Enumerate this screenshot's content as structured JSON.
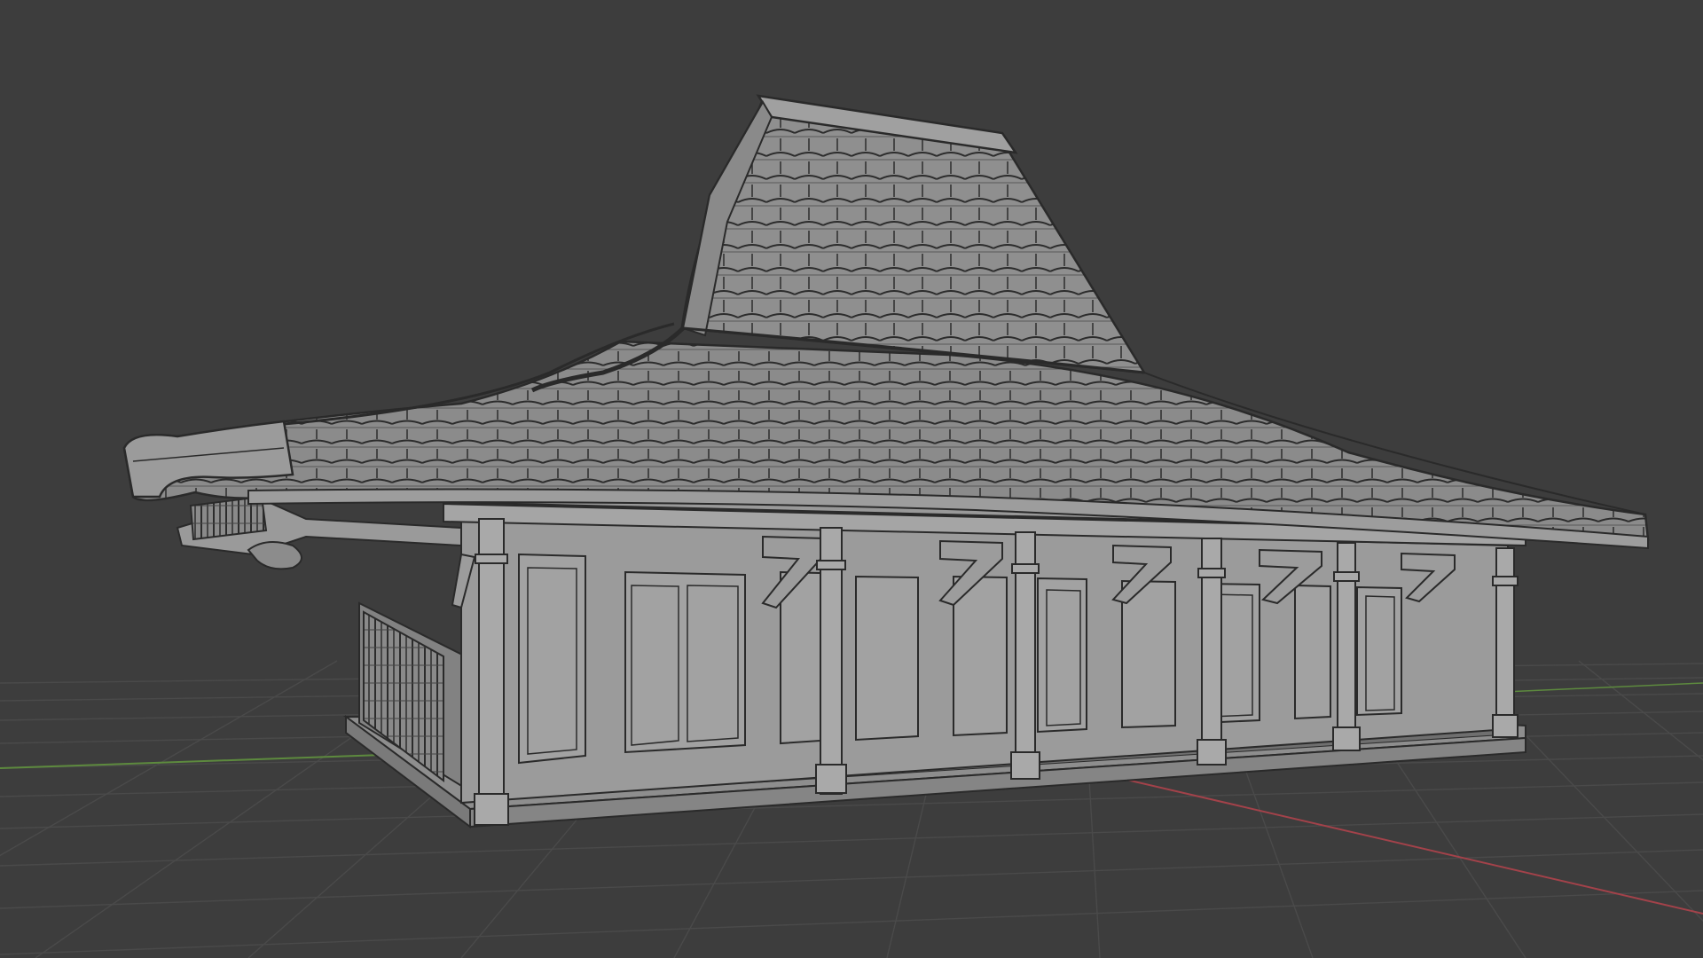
{
  "viewport": {
    "mode": "solid-shading-wireframe",
    "background_color": "#3d3d3d",
    "grid_color": "#4a4a4a",
    "x_axis_color": "#a3424a",
    "y_axis_color": "#5d8a3e",
    "model_color": "#9a9a9a",
    "roof_color": "#8d8d8d",
    "edge_color": "#2a2a2a",
    "model": "joglo-house"
  }
}
